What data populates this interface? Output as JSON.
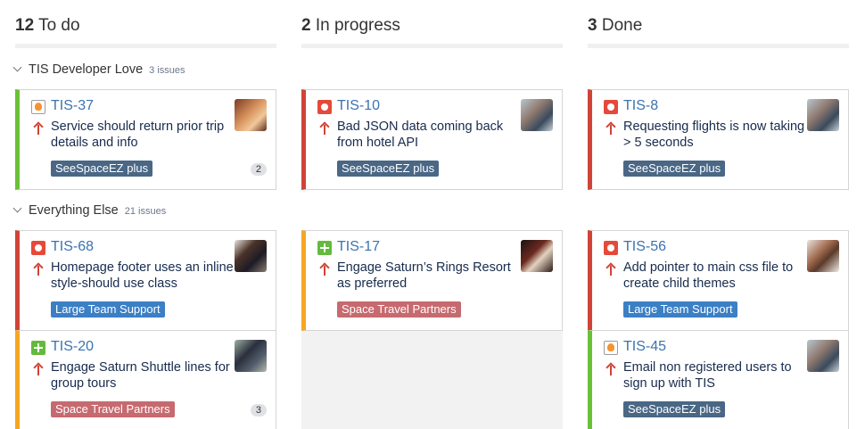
{
  "columns": [
    {
      "count": "12",
      "label": "To do"
    },
    {
      "count": "2",
      "label": "In progress"
    },
    {
      "count": "3",
      "label": "Done"
    }
  ],
  "swimlanes": [
    {
      "name": "TIS Developer Love",
      "issue_count": "3 issues"
    },
    {
      "name": "Everything Else",
      "issue_count": "21 issues"
    }
  ],
  "colors": {
    "bug_border": "#d04437",
    "feature_border": "#6ac036",
    "improvement_border": "#f6a623",
    "epic_blue": "#4a6785",
    "epic_bright_blue": "#3b7fc4",
    "epic_red": "#c66a6f"
  },
  "cards": {
    "tis37": {
      "key": "TIS-37",
      "summary": "Service should return prior trip details and info",
      "epic": "SeeSpaceEZ plus",
      "subtasks": "2",
      "issue_type": "improvement-icon",
      "priority": "priority-high-icon"
    },
    "tis10": {
      "key": "TIS-10",
      "summary": "Bad JSON data coming back from hotel API",
      "epic": "SeeSpaceEZ plus",
      "issue_type": "bug-icon",
      "priority": "priority-high-icon"
    },
    "tis8": {
      "key": "TIS-8",
      "summary": "Requesting flights is now taking > 5 seconds",
      "epic": "SeeSpaceEZ plus",
      "issue_type": "bug-icon",
      "priority": "priority-high-icon"
    },
    "tis68": {
      "key": "TIS-68",
      "summary": "Homepage footer uses an inline style-should use class",
      "epic": "Large Team Support",
      "issue_type": "bug-icon",
      "priority": "priority-high-icon"
    },
    "tis17": {
      "key": "TIS-17",
      "summary": "Engage Saturn’s Rings Resort as preferred",
      "epic": "Space Travel Partners",
      "issue_type": "new-feature-icon",
      "priority": "priority-high-icon"
    },
    "tis56": {
      "key": "TIS-56",
      "summary": "Add pointer to main css file to create child themes",
      "epic": "Large Team Support",
      "issue_type": "bug-icon",
      "priority": "priority-high-icon"
    },
    "tis20": {
      "key": "TIS-20",
      "summary": "Engage Saturn Shuttle lines for group tours",
      "epic": "Space Travel Partners",
      "subtasks": "3",
      "issue_type": "new-feature-icon",
      "priority": "priority-high-icon"
    },
    "tis45": {
      "key": "TIS-45",
      "summary": "Email non registered users to sign up with TIS",
      "epic": "SeeSpaceEZ plus",
      "issue_type": "improvement-icon",
      "priority": "priority-high-icon"
    }
  }
}
